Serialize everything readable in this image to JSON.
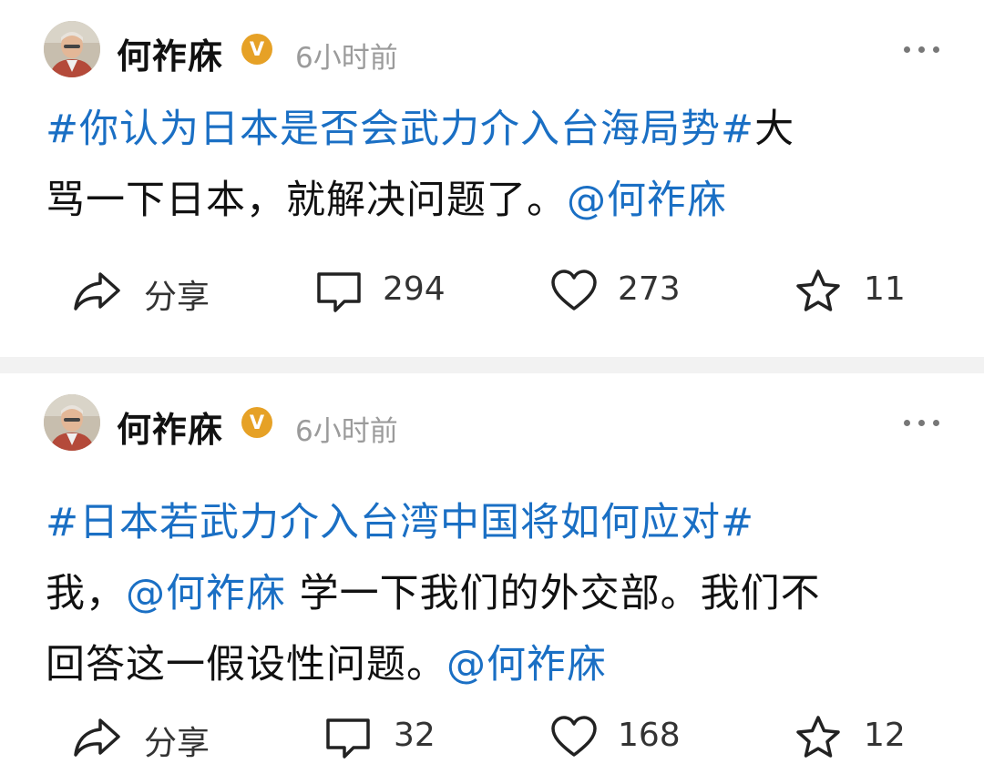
{
  "posts": [
    {
      "author": "何祚庥",
      "verified_badge": "V",
      "time": "6小时前",
      "content_lines": [
        [
          {
            "text": "#你认为日本是否会武力介入台海局势#",
            "link": true
          },
          {
            "text": "大",
            "link": false
          }
        ],
        [
          {
            "text": "骂一下日本，就解决问题了。",
            "link": false
          },
          {
            "text": "@何祚庥",
            "link": true
          }
        ]
      ],
      "actions": {
        "share": "分享",
        "comments": "294",
        "likes": "273",
        "favorites": "11"
      }
    },
    {
      "author": "何祚庥",
      "verified_badge": "V",
      "time": "6小时前",
      "content_lines": [
        [
          {
            "text": "#日本若武力介入台湾中国将如何应对#",
            "link": true
          }
        ],
        [
          {
            "text": "我，",
            "link": false
          },
          {
            "text": "@何祚庥",
            "link": true
          },
          {
            "text": " 学一下我们的外交部。我们不",
            "link": false
          }
        ],
        [
          {
            "text": "回答这一假设性问题。",
            "link": false
          },
          {
            "text": "@何祚庥",
            "link": true
          }
        ]
      ],
      "actions": {
        "share": "分享",
        "comments": "32",
        "likes": "168",
        "favorites": "12"
      }
    }
  ],
  "colors": {
    "link": "#1a6fc4",
    "badge": "#e6a126",
    "timestamp": "#9b9b9b",
    "divider": "#f2f2f2"
  },
  "icons": [
    "share-icon",
    "comment-icon",
    "heart-icon",
    "star-icon",
    "more-icon"
  ]
}
